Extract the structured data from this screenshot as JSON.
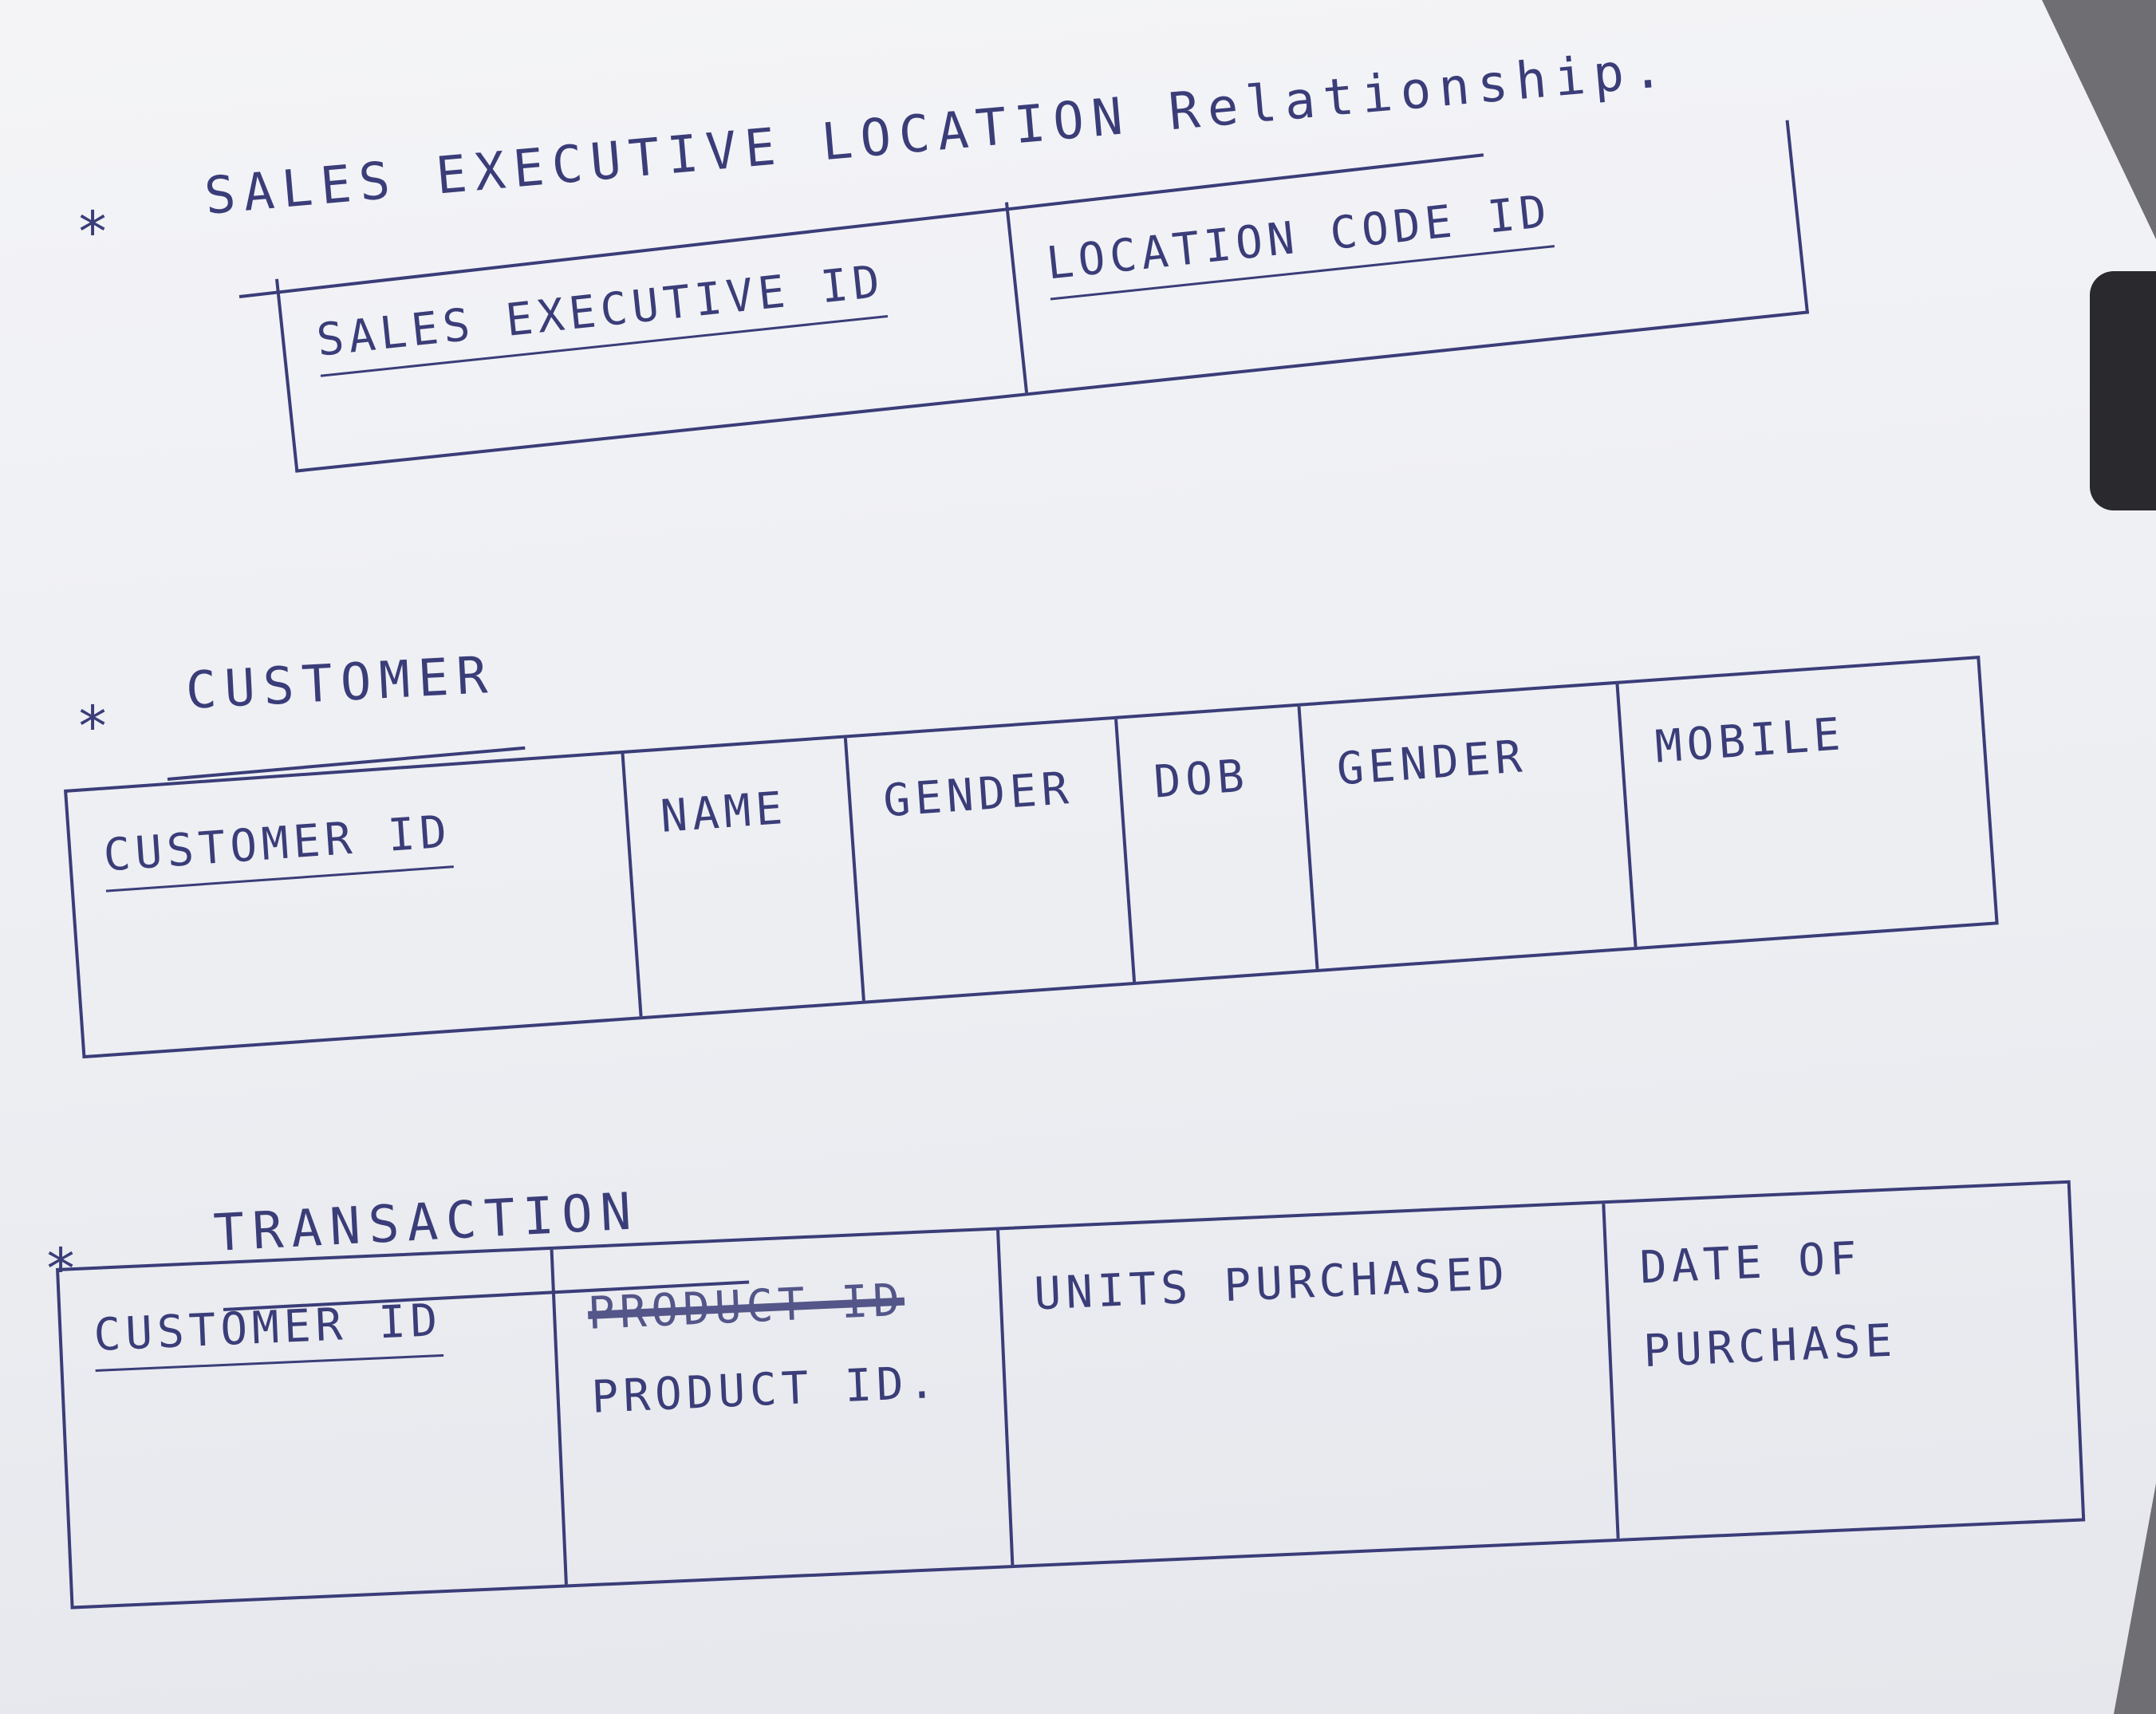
{
  "sections": [
    {
      "title": "SALES EXECUTIVE LOCATION Relationship.",
      "columns": [
        {
          "label": "SALES EXECUTIVE ID",
          "primary_key": true
        },
        {
          "label": "LOCATION CODE ID",
          "primary_key": true
        }
      ]
    },
    {
      "title": "CUSTOMER",
      "columns": [
        {
          "label": "CUSTOMER ID",
          "primary_key": true
        },
        {
          "label": "NAME"
        },
        {
          "label": "GENDER"
        },
        {
          "label": "DOB"
        },
        {
          "label": "GENDER"
        },
        {
          "label": "MOBILE"
        }
      ]
    },
    {
      "title": "TRANSACTION",
      "columns": [
        {
          "label": "CUSTOMER ID",
          "primary_key": true
        },
        {
          "label": "PRODUCT ID",
          "struck": true,
          "correction": "PRODUCT ID."
        },
        {
          "label": "UNITS PURCHASED"
        },
        {
          "label": "DATE OF",
          "label2": "PURCHASE"
        }
      ]
    }
  ],
  "bullet": "*",
  "colors": {
    "ink": "#3a3d78",
    "paper": "#eceef2"
  }
}
